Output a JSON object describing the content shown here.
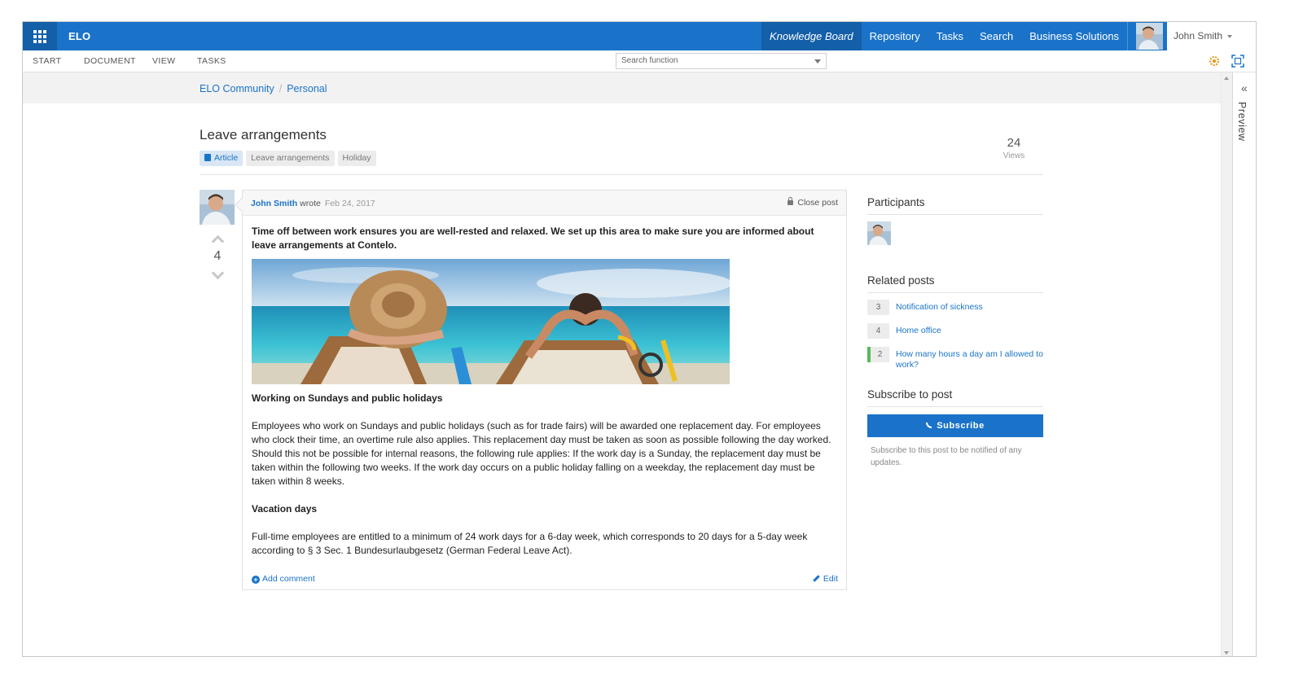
{
  "app": {
    "brand": "ELO"
  },
  "nav": {
    "items": [
      "Knowledge Board",
      "Repository",
      "Tasks",
      "Search",
      "Business Solutions"
    ],
    "active": "Knowledge Board"
  },
  "user": {
    "name": "John Smith"
  },
  "ribbon": {
    "tabs": [
      "START",
      "DOCUMENT",
      "VIEW",
      "TASKS"
    ],
    "search_placeholder": "Search function"
  },
  "breadcrumb": [
    "ELO Community",
    "Personal"
  ],
  "post": {
    "title": "Leave arrangements",
    "tags": [
      "Article",
      "Leave arrangements",
      "Holiday"
    ],
    "views_count": "24",
    "views_label": "Views",
    "author": "John Smith",
    "wrote": "wrote",
    "date": "Feb 24, 2017",
    "close_label": "Close post",
    "votes": "4",
    "lead": "Time off between work ensures you are well-rested and relaxed. We set up this area to make sure you are informed about leave arrangements at Contelo.",
    "section1_title": "Working on Sundays and public holidays",
    "section1_text": "Employees who work on Sundays and public holidays (such as for trade fairs) will be awarded one replacement day. For employees who clock their time, an overtime rule also applies. This replacement day must be taken as soon as possible following the day worked. Should this not be possible for internal reasons, the following rule applies: If the work day is a Sunday, the replacement day must be taken within the following two weeks. If the work day occurs on a public holiday falling on a weekday, the replacement day must be taken within 8 weeks.",
    "section2_title": "Vacation days",
    "section2_text": "Full-time employees are entitled to a minimum of 24 work days for a 6-day week, which corresponds to 20 days for a 5-day week according to § 3 Sec. 1 Bundesurlaubgesetz (German Federal Leave Act).",
    "add_comment": "Add comment",
    "edit": "Edit"
  },
  "sidebar": {
    "participants_title": "Participants",
    "related_title": "Related posts",
    "related": [
      {
        "count": "3",
        "title": "Notification of sickness"
      },
      {
        "count": "4",
        "title": "Home office"
      },
      {
        "count": "2",
        "title": "How many hours a day am I allowed to work?"
      }
    ],
    "subscribe_title": "Subscribe to post",
    "subscribe_button": "Subscribe",
    "subscribe_note": "Subscribe to this post to be notified of any updates."
  },
  "preview_pane": {
    "label": "Preview"
  },
  "colors": {
    "brand_blue": "#1a73c8",
    "nav_active": "#135fa8",
    "related_accent": "#5cb85c"
  }
}
